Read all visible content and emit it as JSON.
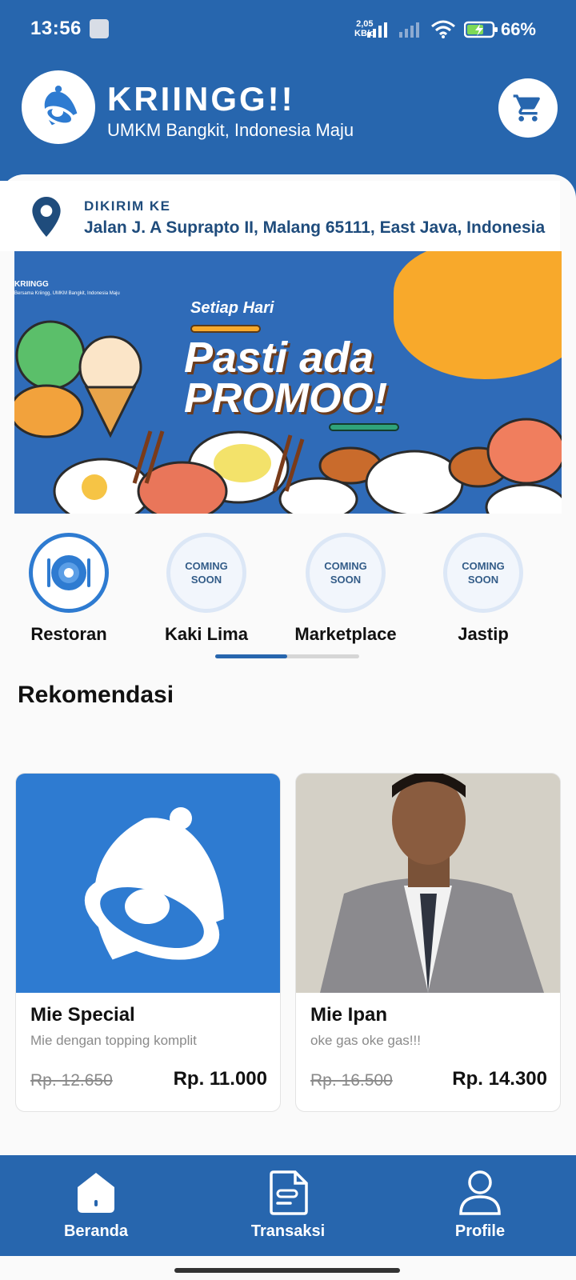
{
  "status_bar": {
    "time": "13:56",
    "net_speed_top": "2,05",
    "net_speed_bottom": "KB/d",
    "battery": "66%"
  },
  "header": {
    "title": "KRIINGG!!",
    "subtitle": "UMKM Bangkit, Indonesia Maju",
    "logo_icon": "bell-icon",
    "cart_icon": "cart-icon"
  },
  "address": {
    "label": "DIKIRIM KE",
    "value": "Jalan J. A Suprapto II, Malang 65111, East Java, Indonesia"
  },
  "banner": {
    "brand": "KRIINGG",
    "brand_sub": "Bersama Kriingg, UMKM Bangkit, Indonesia Maju",
    "everyday": "Setiap Hari",
    "promo_line1": "Pasti ada",
    "promo_line2": "PROMOO!"
  },
  "categories": [
    {
      "label": "Restoran",
      "badge": "",
      "active": true
    },
    {
      "label": "Kaki Lima",
      "badge": "COMING SOON",
      "active": false
    },
    {
      "label": "Marketplace",
      "badge": "COMING SOON",
      "active": false
    },
    {
      "label": "Jastip",
      "badge": "COMING SOON",
      "active": false
    }
  ],
  "categories_scroll": {
    "position": 0.5
  },
  "recommendations": {
    "title": "Rekomendasi",
    "items": [
      {
        "name": "Mie Special",
        "description": "Mie dengan topping komplit",
        "old_price": "Rp. 12.650",
        "price": "Rp. 11.000"
      },
      {
        "name": "Mie Ipan",
        "description": "oke gas oke gas!!!",
        "old_price": "Rp. 16.500",
        "price": "Rp. 14.300"
      }
    ]
  },
  "bottom_nav": [
    {
      "label": "Beranda",
      "icon": "home-icon"
    },
    {
      "label": "Transaksi",
      "icon": "receipt-icon"
    },
    {
      "label": "Profile",
      "icon": "profile-icon"
    }
  ],
  "colors": {
    "primary": "#2766AE",
    "accent": "#2E7BD1",
    "promo_orange": "#F8A92B"
  }
}
